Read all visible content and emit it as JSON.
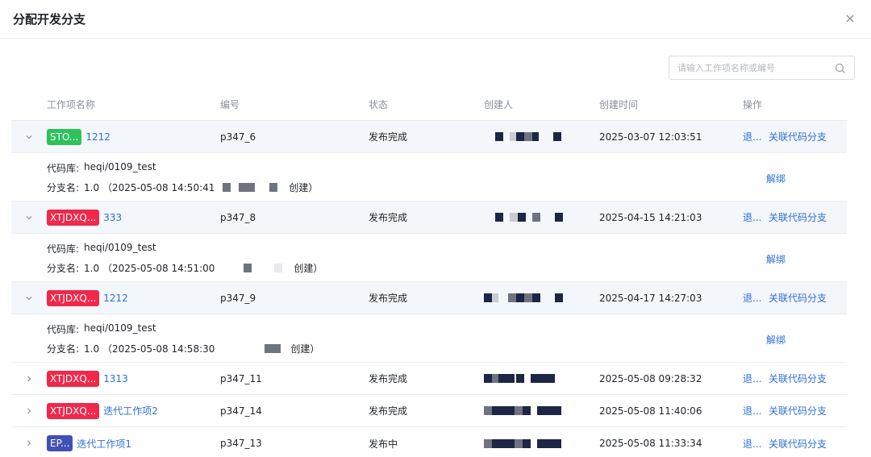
{
  "dialog": {
    "title": "分配开发分支",
    "close_icon": "close-icon"
  },
  "search": {
    "placeholder": "请输入工作项名称或编号",
    "value": ""
  },
  "columns": {
    "name": "工作项名称",
    "code": "编号",
    "status": "状态",
    "creator": "创建人",
    "created_at": "创建时间",
    "ops": "操作"
  },
  "rows": [
    {
      "tag": "STO...",
      "tag_color": "#2fc25b",
      "name": "1212",
      "code": "p347_6",
      "status": "发布完成",
      "created_at": "2025-03-07 12:03:51",
      "op1": "退...",
      "op2": "关联代码分支",
      "expanded": true,
      "detail": {
        "repo_label": "代码库:",
        "repo": "heqi/0109_test",
        "branch_label": "分支名:",
        "branch": "1.0 （2025-05-08 14:50:41",
        "created_suffix": "创建）",
        "unbind": "解绑"
      }
    },
    {
      "tag": "XTJDXQ...",
      "tag_color": "#f0284a",
      "name": "333",
      "code": "p347_8",
      "status": "发布完成",
      "created_at": "2025-04-15 14:21:03",
      "op1": "退...",
      "op2": "关联代码分支",
      "expanded": true,
      "detail": {
        "repo_label": "代码库:",
        "repo": "heqi/0109_test",
        "branch_label": "分支名:",
        "branch": "1.0 （2025-05-08 14:51:00",
        "created_suffix": "创建）",
        "unbind": "解绑"
      }
    },
    {
      "tag": "XTJDXQ...",
      "tag_color": "#f0284a",
      "name": "1212",
      "code": "p347_9",
      "status": "发布完成",
      "created_at": "2025-04-17 14:27:03",
      "op1": "退...",
      "op2": "关联代码分支",
      "expanded": true,
      "detail": {
        "repo_label": "代码库:",
        "repo": "heqi/0109_test",
        "branch_label": "分支名:",
        "branch": "1.0 （2025-05-08 14:58:30",
        "created_suffix": "创建）",
        "unbind": "解绑"
      }
    },
    {
      "tag": "XTJDXQ...",
      "tag_color": "#f0284a",
      "name": "1313",
      "code": "p347_11",
      "status": "发布完成",
      "created_at": "2025-05-08 09:28:32",
      "op1": "退...",
      "op2": "关联代码分支",
      "expanded": false
    },
    {
      "tag": "XTJDXQ...",
      "tag_color": "#f0284a",
      "name": "迭代工作项2",
      "code": "p347_14",
      "status": "发布完成",
      "created_at": "2025-05-08 11:40:06",
      "op1": "退...",
      "op2": "关联代码分支",
      "expanded": false
    },
    {
      "tag": "EP...",
      "tag_color": "#3f51b5",
      "name": "迭代工作项1",
      "code": "p347_13",
      "status": "发布中",
      "created_at": "2025-05-08 11:33:34",
      "op1": "退...",
      "op2": "关联代码分支",
      "expanded": false
    }
  ]
}
